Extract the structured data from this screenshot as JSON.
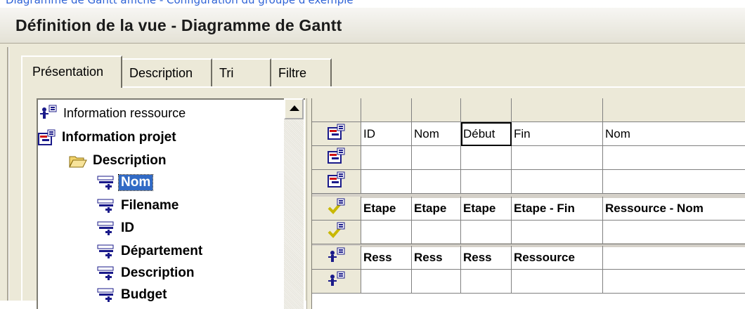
{
  "caption_fragment": "Diagramme de Gantt affiché - Configuration du groupe d'exemple",
  "window": {
    "title": "Définition de la vue - Diagramme de Gantt"
  },
  "tabs": [
    {
      "label": "Présentation",
      "active": true
    },
    {
      "label": "Description",
      "active": false
    },
    {
      "label": "Tri",
      "active": false
    },
    {
      "label": "Filtre",
      "active": false
    }
  ],
  "tree": {
    "items": [
      {
        "label": "Information ressource",
        "icon": "resource-info-icon",
        "bold": false,
        "level": 0
      },
      {
        "label": "Information projet",
        "icon": "project-info-icon",
        "bold": true,
        "level": 0
      },
      {
        "label": "Description",
        "icon": "folder-open-icon",
        "bold": true,
        "level": 1
      },
      {
        "label": "Nom",
        "icon": "field-icon",
        "bold": true,
        "level": 2,
        "selected": true
      },
      {
        "label": "Filename",
        "icon": "field-icon",
        "bold": true,
        "level": 2
      },
      {
        "label": "ID",
        "icon": "field-icon",
        "bold": true,
        "level": 2
      },
      {
        "label": "Département",
        "icon": "field-icon",
        "bold": true,
        "level": 2
      },
      {
        "label": "Description",
        "icon": "field-icon",
        "bold": true,
        "level": 2
      },
      {
        "label": "Budget",
        "icon": "field-icon",
        "bold": true,
        "level": 2
      }
    ]
  },
  "grid": {
    "rows": [
      {
        "icon": "project-row-icon",
        "cells": [
          "ID",
          "Nom",
          "Début",
          "Fin",
          "Nom"
        ],
        "bold": false,
        "boxed_col": 2
      },
      {
        "icon": "project-row-icon",
        "cells": [
          "",
          "",
          "",
          "",
          ""
        ],
        "bold": false
      },
      {
        "icon": "project-row-icon",
        "cells": [
          "",
          "",
          "",
          "",
          ""
        ],
        "bold": false
      },
      {
        "icon": "task-row-icon",
        "cells": [
          "Etape",
          "Etape",
          "Etape",
          "Etape - Fin",
          "Ressource - Nom"
        ],
        "bold": true
      },
      {
        "icon": "task-row-icon",
        "cells": [
          "",
          "",
          "",
          "",
          ""
        ],
        "bold": false
      },
      {
        "icon": "resource-row-icon",
        "cells": [
          "Ress",
          "Ress",
          "Ress",
          "Ressource",
          ""
        ],
        "bold": true
      },
      {
        "icon": "resource-row-icon",
        "cells": [
          "",
          "",
          "",
          "",
          ""
        ],
        "bold": false
      }
    ]
  },
  "colors": {
    "selection": "#316ac5",
    "dialog_bg": "#ece9d8",
    "caption": "#2f63d6"
  }
}
